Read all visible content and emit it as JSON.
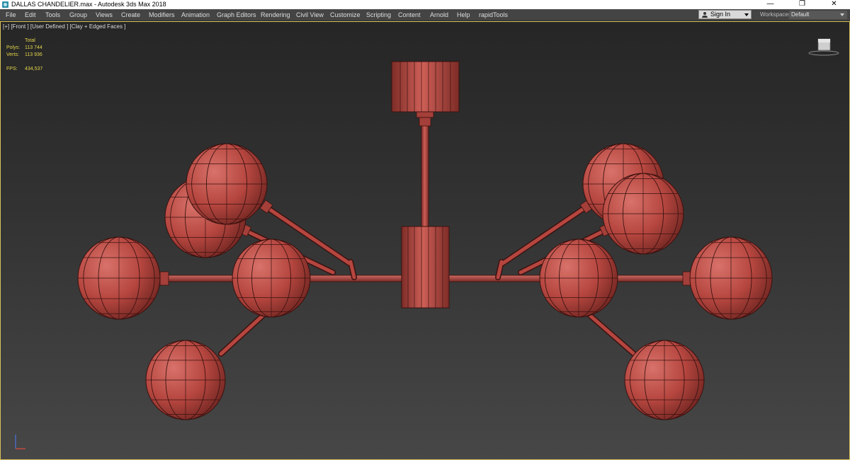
{
  "window": {
    "title": "DALLAS CHANDELIER.max - Autodesk 3ds Max 2018",
    "controls": {
      "minimize": "—",
      "restore": "❐",
      "close": "✕"
    }
  },
  "menubar": {
    "items": [
      "File",
      "Edit",
      "Tools",
      "Group",
      "Views",
      "Create",
      "Modifiers",
      "Animation",
      "Graph Editors",
      "Rendering",
      "Civil View",
      "Customize",
      "Scripting",
      "Content",
      "Arnold",
      "Help",
      "rapidTools"
    ],
    "signin": "Sign In",
    "workspaces_label": "Workspaces:",
    "workspaces_value": "Default"
  },
  "viewport": {
    "label": "[+] [Front ] [User Defined ] [Clay + Edged Faces ]",
    "stats": {
      "header": "Total",
      "polys_label": "Polys:",
      "polys_value": "113 744",
      "verts_label": "Verts:",
      "verts_value": "113 936",
      "fps_label": "FPS:",
      "fps_value": "434,537"
    }
  },
  "colors": {
    "clay": "#b5463f",
    "clay_dark": "#6e2420",
    "wire": "#3a1210",
    "stats": "#e3d34a",
    "viewport_border": "#d6c25a"
  }
}
